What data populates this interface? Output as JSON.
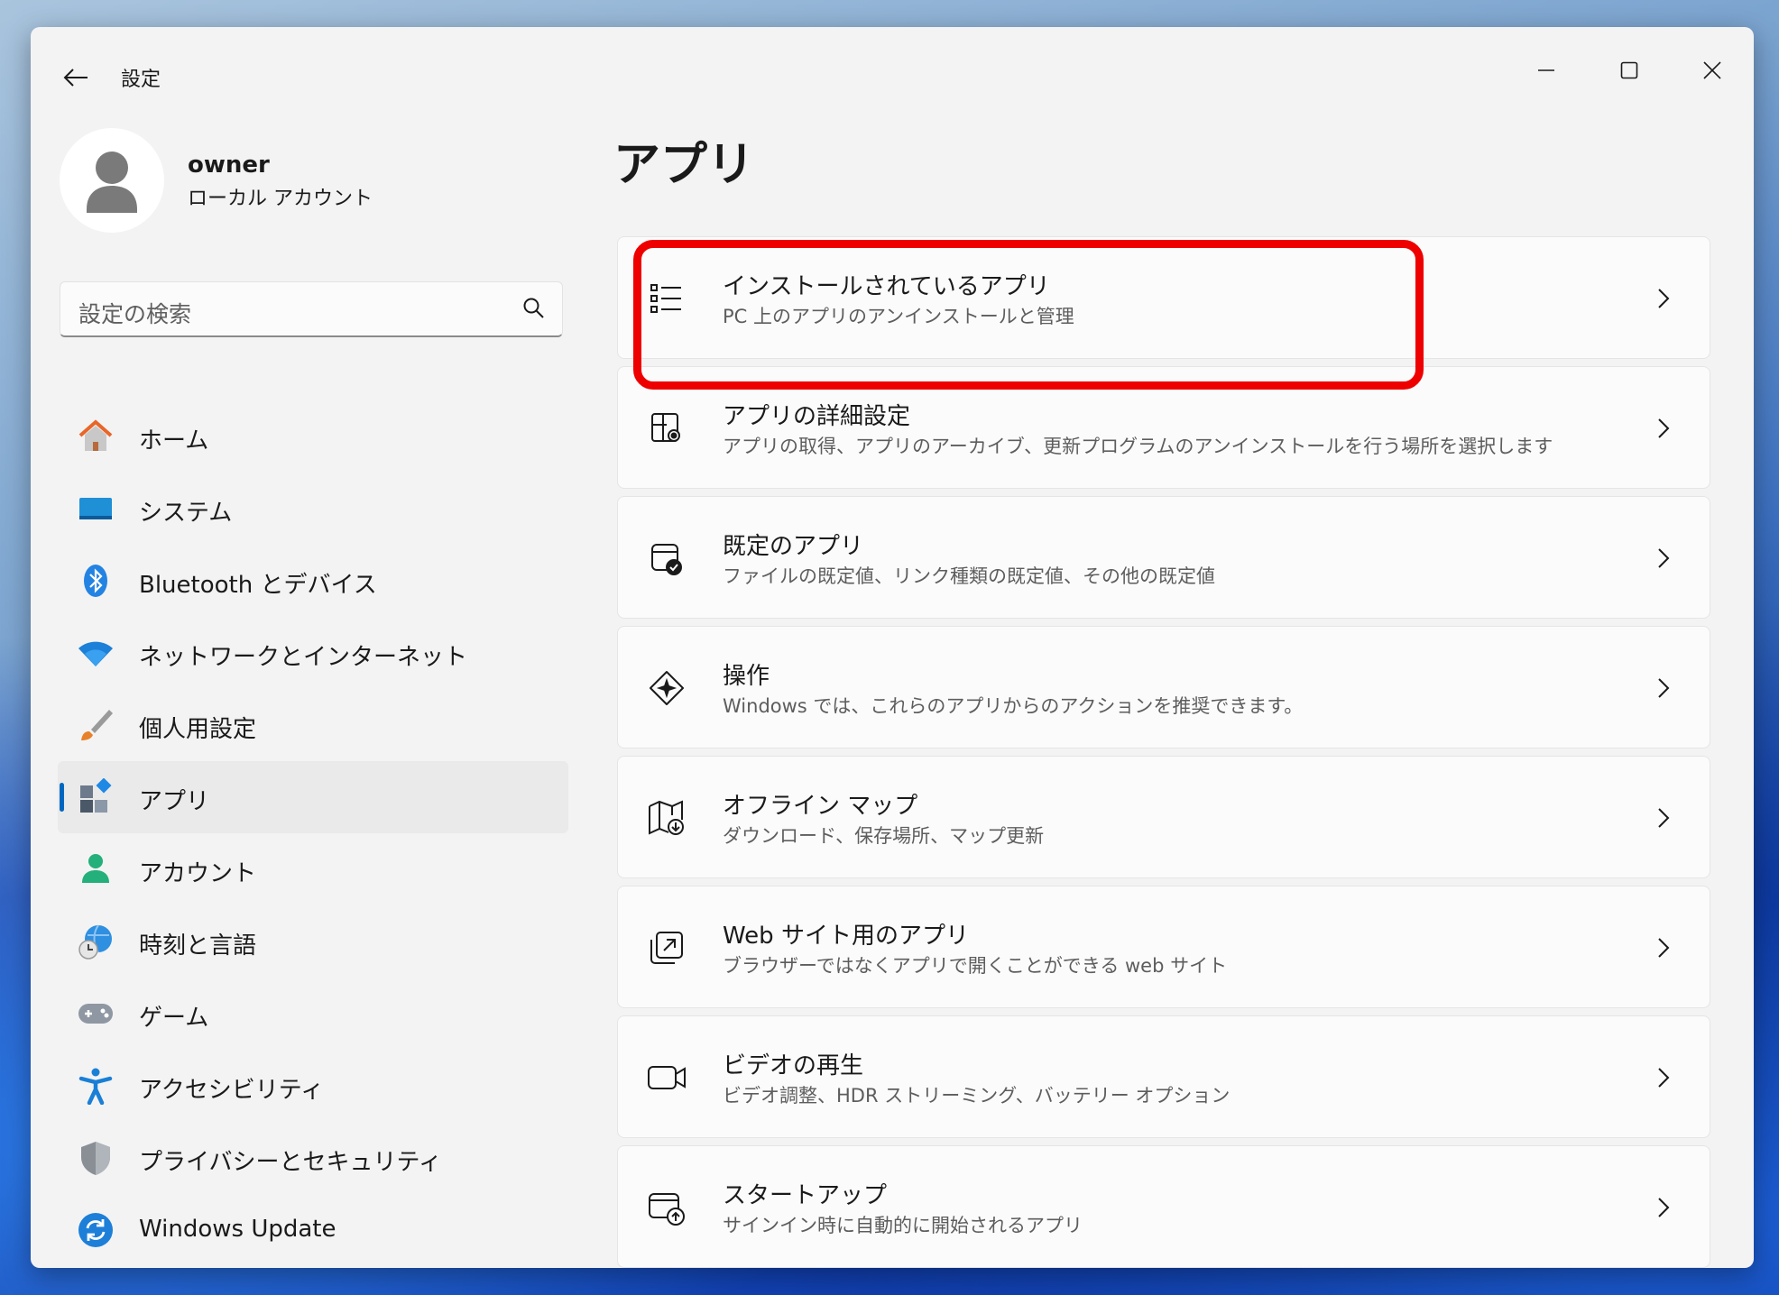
{
  "window": {
    "title": "設定"
  },
  "profile": {
    "name": "owner",
    "account_type": "ローカル アカウント"
  },
  "search": {
    "placeholder": "設定の検索"
  },
  "sidebar": {
    "items": [
      {
        "label": "ホーム",
        "icon": "home-icon"
      },
      {
        "label": "システム",
        "icon": "system-icon"
      },
      {
        "label": "Bluetooth とデバイス",
        "icon": "bluetooth-icon"
      },
      {
        "label": "ネットワークとインターネット",
        "icon": "wifi-icon"
      },
      {
        "label": "個人用設定",
        "icon": "brush-icon"
      },
      {
        "label": "アプリ",
        "icon": "apps-icon",
        "selected": true
      },
      {
        "label": "アカウント",
        "icon": "person-icon"
      },
      {
        "label": "時刻と言語",
        "icon": "globe-clock-icon"
      },
      {
        "label": "ゲーム",
        "icon": "gamepad-icon"
      },
      {
        "label": "アクセシビリティ",
        "icon": "accessibility-icon"
      },
      {
        "label": "プライバシーとセキュリティ",
        "icon": "shield-icon"
      },
      {
        "label": "Windows Update",
        "icon": "update-icon"
      }
    ]
  },
  "main": {
    "title": "アプリ",
    "cards": [
      {
        "title": "インストールされているアプリ",
        "subtitle": "PC 上のアプリのアンインストールと管理",
        "icon": "list-icon",
        "highlighted": true
      },
      {
        "title": "アプリの詳細設定",
        "subtitle": "アプリの取得、アプリのアーカイブ、更新プログラムのアンインストールを行う場所を選択します",
        "icon": "app-settings-icon"
      },
      {
        "title": "既定のアプリ",
        "subtitle": "ファイルの既定値、リンク種類の既定値、その他の既定値",
        "icon": "default-apps-icon"
      },
      {
        "title": "操作",
        "subtitle": "Windows では、これらのアプリからのアクションを推奨できます。",
        "icon": "actions-icon"
      },
      {
        "title": "オフライン マップ",
        "subtitle": "ダウンロード、保存場所、マップ更新",
        "icon": "map-icon"
      },
      {
        "title": "Web サイト用のアプリ",
        "subtitle": "ブラウザーではなくアプリで開くことができる web サイト",
        "icon": "open-external-icon"
      },
      {
        "title": "ビデオの再生",
        "subtitle": "ビデオ調整、HDR ストリーミング、バッテリー オプション",
        "icon": "video-icon"
      },
      {
        "title": "スタートアップ",
        "subtitle": "サインイン時に自動的に開始されるアプリ",
        "icon": "startup-icon"
      }
    ]
  },
  "colors": {
    "accent": "#0067c0",
    "highlight": "#ee0000"
  }
}
